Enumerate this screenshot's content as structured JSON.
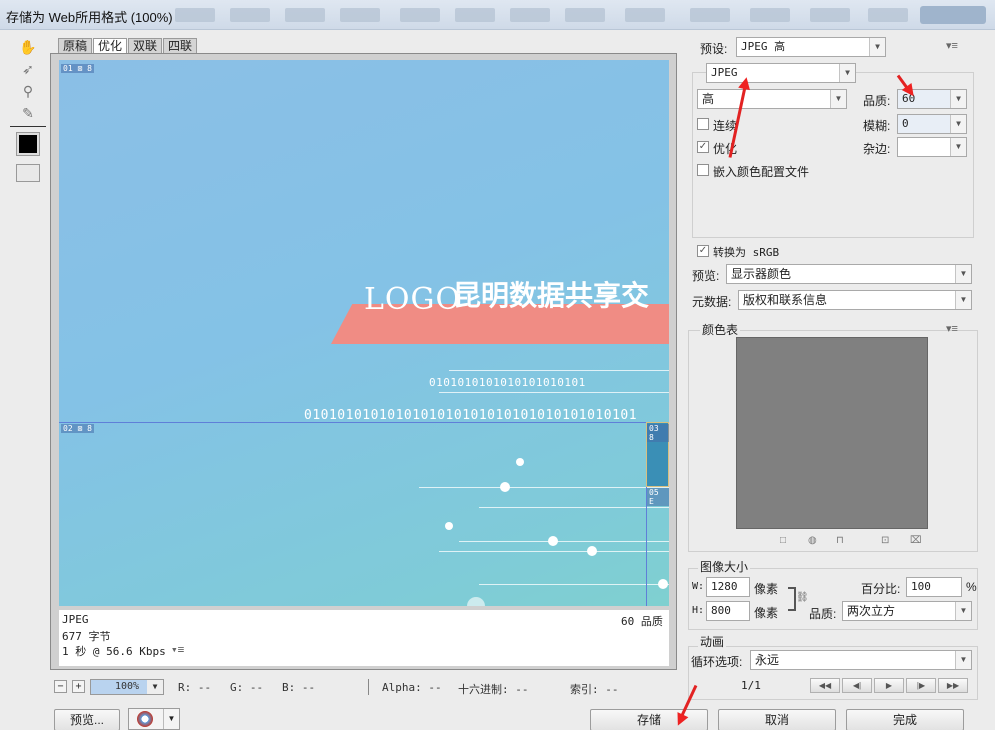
{
  "window": {
    "title": "存储为 Web所用格式 (100%)"
  },
  "tabs": [
    {
      "label": "原稿",
      "active": false
    },
    {
      "label": "优化",
      "active": true
    },
    {
      "label": "双联",
      "active": false
    },
    {
      "label": "四联",
      "active": false
    }
  ],
  "image": {
    "logo_text": "LOGO",
    "headline": "昆明数据共享交",
    "binary_row_1": "0101010101010101010101",
    "binary_row_2": "0101010101010101010101010101010101010101",
    "slices": {
      "s01": "01 ⊠ 8",
      "s02": "02 ⊠ 8",
      "s03": "03 8",
      "s05": "05 E"
    }
  },
  "info_panel": {
    "format": "JPEG",
    "size": "677 字节",
    "time": "1 秒 @ 56.6 Kbps",
    "quality_note": "60 品质"
  },
  "settings": {
    "preset_label": "预设:",
    "preset_value": "JPEG 高",
    "format_value": "JPEG",
    "compression_value": "高",
    "quality_label": "品质:",
    "quality_value": "60",
    "blur_label": "模糊:",
    "blur_value": "0",
    "matte_label": "杂边:",
    "progressive_label": "连续",
    "progressive_checked": false,
    "optimized_label": "优化",
    "optimized_checked": true,
    "embed_profile_label": "嵌入颜色配置文件",
    "embed_profile_checked": false,
    "convert_srgb_label": "转换为 sRGB",
    "convert_srgb_checked": true,
    "preview_label": "预览:",
    "preview_value": "显示器颜色",
    "metadata_label": "元数据:",
    "metadata_value": "版权和联系信息"
  },
  "color_table": {
    "label": "颜色表",
    "swatch_color": "#808080"
  },
  "image_size": {
    "label": "图像大小",
    "w_label": "W:",
    "w_value": "1280",
    "h_label": "H:",
    "h_value": "800",
    "unit": "像素",
    "percent_label": "百分比:",
    "percent_value": "100",
    "percent_unit": "%",
    "quality_label": "品质:",
    "quality_value": "两次立方"
  },
  "animation": {
    "label": "动画",
    "loop_label": "循环选项:",
    "loop_value": "永远",
    "frame": "1/1"
  },
  "statusbar": {
    "zoom": "100%",
    "r": "R: --",
    "g": "G: --",
    "b": "B: --",
    "alpha": "Alpha: --",
    "hex": "十六进制: --",
    "index": "索引: --"
  },
  "buttons": {
    "preview": "预览...",
    "save": "存储",
    "cancel": "取消",
    "done": "完成"
  },
  "colors": {
    "accent_red": "#e22222",
    "slice_band": "#f08c84"
  }
}
